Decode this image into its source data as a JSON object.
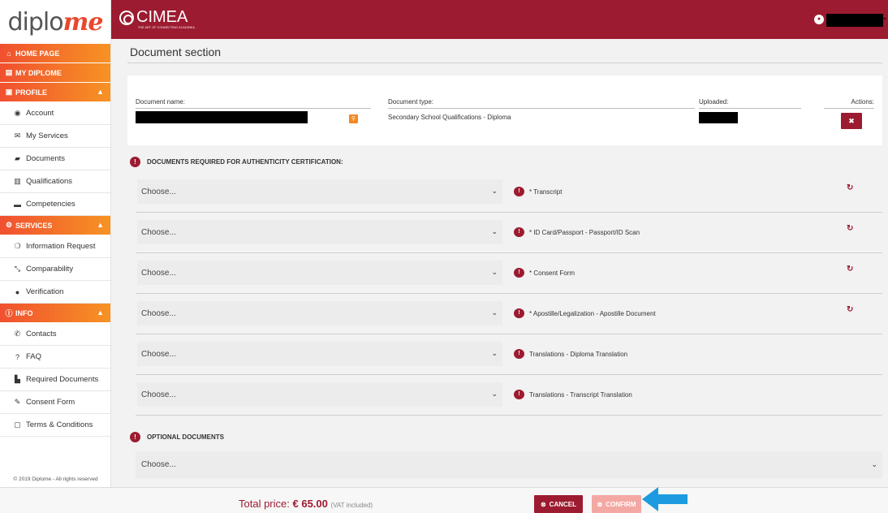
{
  "brand": {
    "logo_main": "diplo",
    "logo_accent": "me",
    "partner": "CIMEA",
    "partner_tagline": "THE ART OF CONNECTING ACADEMIA"
  },
  "sidebar": {
    "items": [
      {
        "label": "HOME PAGE",
        "icon": "home-icon",
        "type": "main"
      },
      {
        "label": "MY DIPLOME",
        "icon": "credit-card-icon",
        "type": "main"
      },
      {
        "label": "PROFILE",
        "icon": "id-card-icon",
        "type": "main",
        "expanded": true
      },
      {
        "label": "Account",
        "icon": "user-circle-icon",
        "type": "sub"
      },
      {
        "label": "My Services",
        "icon": "envelope-icon",
        "type": "sub"
      },
      {
        "label": "Documents",
        "icon": "book-icon",
        "type": "sub"
      },
      {
        "label": "Qualifications",
        "icon": "certificate-icon",
        "type": "sub"
      },
      {
        "label": "Competencies",
        "icon": "briefcase-icon",
        "type": "sub"
      },
      {
        "label": "SERVICES",
        "icon": "cogs-icon",
        "type": "main",
        "expanded": true
      },
      {
        "label": "Information Request",
        "icon": "chat-icon",
        "type": "sub"
      },
      {
        "label": "Comparability",
        "icon": "compare-icon",
        "type": "sub"
      },
      {
        "label": "Verification",
        "icon": "dot-icon",
        "type": "sub"
      },
      {
        "label": "INFO",
        "icon": "info-icon",
        "type": "main",
        "expanded": true
      },
      {
        "label": "Contacts",
        "icon": "phone-icon",
        "type": "sub"
      },
      {
        "label": "FAQ",
        "icon": "question-icon",
        "type": "sub"
      },
      {
        "label": "Required Documents",
        "icon": "file-icon",
        "type": "sub"
      },
      {
        "label": "Consent Form",
        "icon": "pencil-icon",
        "type": "sub"
      },
      {
        "label": "Terms & Conditions",
        "icon": "document-icon",
        "type": "sub"
      }
    ],
    "copyright": "© 2019 Diplome - All rights reserved"
  },
  "main": {
    "title": "Document section",
    "document": {
      "name_label": "Document name:",
      "type_label": "Document type:",
      "type_value": "Secondary School Qualifications - Diploma",
      "uploaded_label": "Uploaded:",
      "actions_label": "Actions:"
    },
    "required_heading": "DOCUMENTS REQUIRED FOR AUTHENTICITY CERTIFICATION:",
    "rows": [
      {
        "choose": "Choose...",
        "label": "* Transcript",
        "refresh": true
      },
      {
        "choose": "Choose...",
        "label": "* ID Card/Passport - Passport/ID Scan",
        "refresh": true
      },
      {
        "choose": "Choose...",
        "label": "* Consent Form",
        "refresh": true
      },
      {
        "choose": "Choose...",
        "label": "* Apostille/Legalization - Apostille Document",
        "refresh": true
      },
      {
        "choose": "Choose...",
        "label": "Translations - Diploma Translation",
        "refresh": false
      },
      {
        "choose": "Choose...",
        "label": "Translations - Transcript Translation",
        "refresh": false
      }
    ],
    "optional_heading": "OPTIONAL DOCUMENTS",
    "optional_choose": "Choose..."
  },
  "footer": {
    "total_label": "Total price:",
    "total_amount": "€ 65.00",
    "vat_note": "(VAT included)",
    "cancel_label": "CANCEL",
    "confirm_label": "CONFIRM"
  },
  "colors": {
    "brand": "#9c1b30",
    "accent_orange": "#f79324",
    "accent_red": "#f0502f",
    "arrow": "#1e9be0"
  }
}
